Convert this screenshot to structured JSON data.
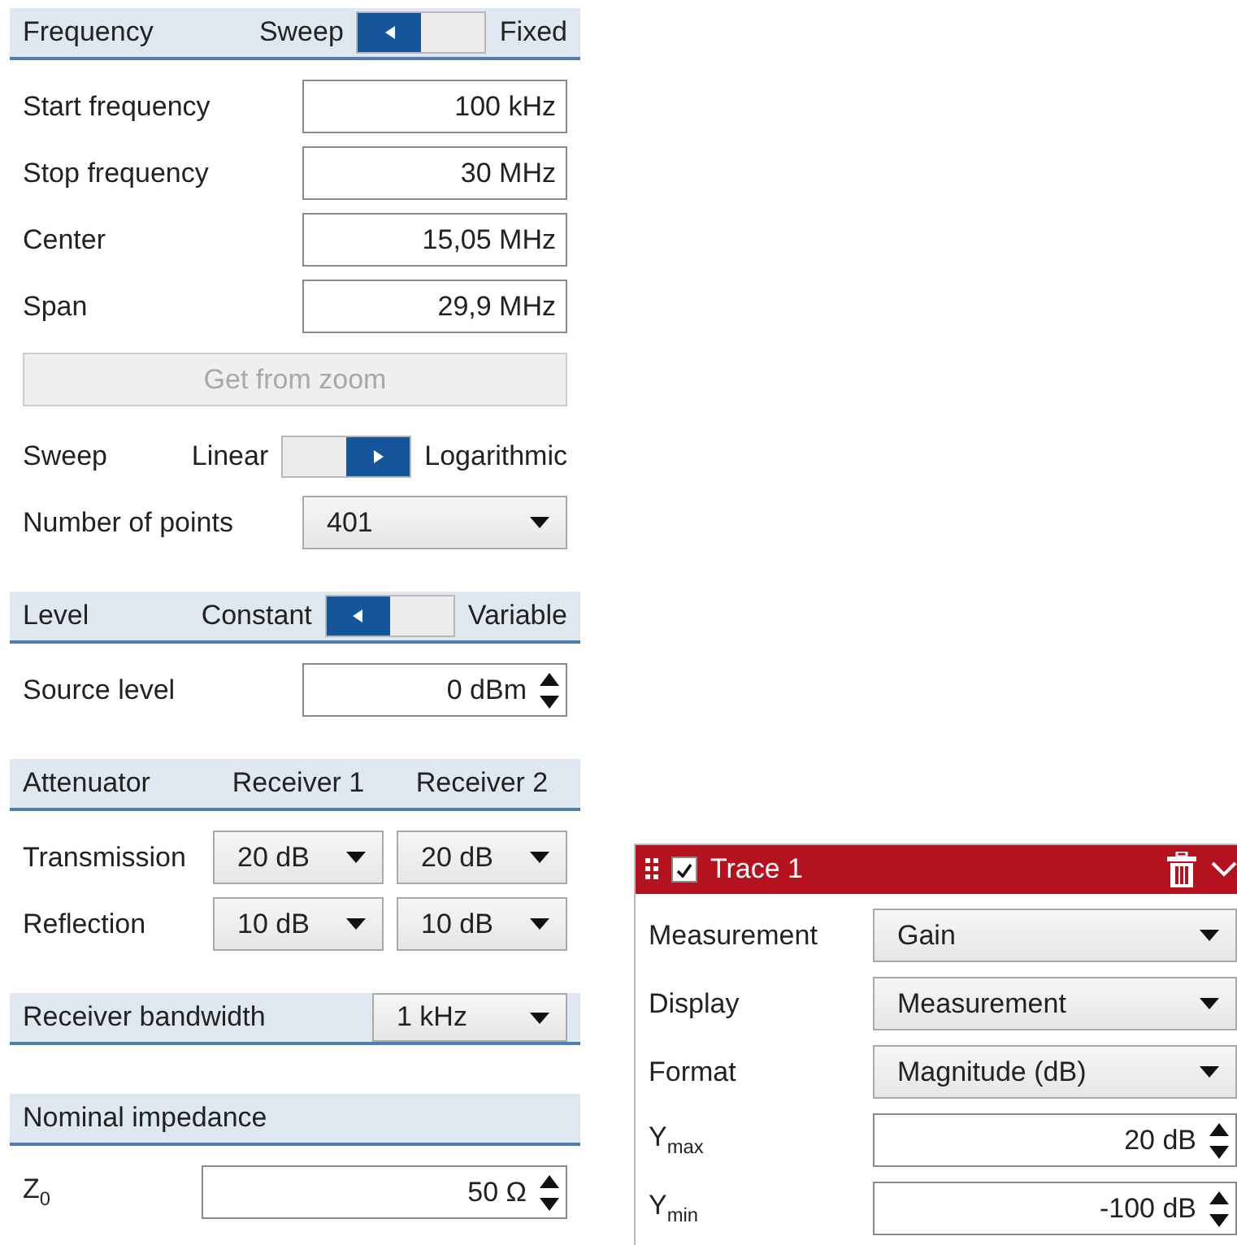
{
  "frequency": {
    "title": "Frequency",
    "toggle": [
      {
        "label": "Sweep",
        "selected": true
      },
      {
        "label": "Fixed",
        "selected": false
      }
    ],
    "fields": [
      {
        "label": "Start frequency",
        "value": "100 kHz"
      },
      {
        "label": "Stop frequency",
        "value": "30 MHz"
      },
      {
        "label": "Center",
        "value": "15,05 MHz"
      },
      {
        "label": "Span",
        "value": "29,9 MHz"
      }
    ],
    "zoom_button": {
      "label": "Get from zoom",
      "disabled": true
    },
    "sweep": {
      "label": "Sweep",
      "toggle": [
        {
          "label": "Linear",
          "selected": false
        },
        {
          "label": "Logarithmic",
          "selected": true
        }
      ]
    },
    "points": {
      "label": "Number of points",
      "value": "401"
    }
  },
  "level": {
    "title": "Level",
    "toggle": [
      {
        "label": "Constant",
        "selected": true
      },
      {
        "label": "Variable",
        "selected": false
      }
    ],
    "source_level": {
      "label": "Source level",
      "value": "0 dBm"
    }
  },
  "attenuator": {
    "title": "Attenuator",
    "columns": [
      "Receiver 1",
      "Receiver 2"
    ],
    "rows": [
      {
        "label": "Transmission",
        "values": [
          "20 dB",
          "20 dB"
        ]
      },
      {
        "label": "Reflection",
        "values": [
          "10 dB",
          "10 dB"
        ]
      }
    ]
  },
  "receiver_bandwidth": {
    "title": "Receiver bandwidth",
    "value": "1 kHz"
  },
  "impedance": {
    "title": "Nominal impedance",
    "label": "Z$_{0}$",
    "value": "50 Ω"
  },
  "trace": {
    "title": "Trace 1",
    "checked": true,
    "rows": [
      {
        "kind": "dropdown",
        "label": "Measurement",
        "value": "Gain"
      },
      {
        "kind": "dropdown",
        "label": "Display",
        "value": "Measurement"
      },
      {
        "kind": "dropdown",
        "label": "Format",
        "value": "Magnitude (dB)"
      },
      {
        "kind": "spin",
        "label": "Y$_{max}$",
        "value": "20 dB"
      },
      {
        "kind": "spin",
        "label": "Y$_{min}$",
        "value": "-100 dB"
      }
    ]
  }
}
